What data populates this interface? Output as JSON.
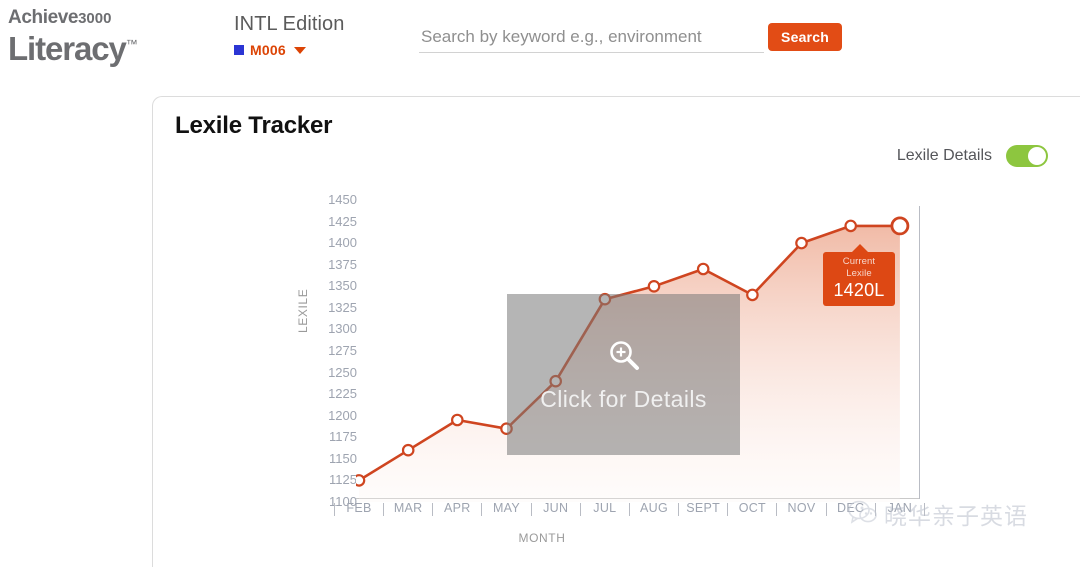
{
  "header": {
    "logo_top": "Achieve",
    "logo_top_sub": "3000",
    "logo_bottom": "Literacy",
    "logo_tm": "™",
    "edition_title": "INTL Edition",
    "edition_code": "M006",
    "caret_icon": "chevron-down-icon",
    "square_icon": "blue-square-icon",
    "square_color": "#2b35d4",
    "search_placeholder": "Search by keyword e.g., environment",
    "search_value": "",
    "search_button": "Search",
    "search_button_color": "#e24c15"
  },
  "card": {
    "title": "Lexile Tracker",
    "toggle_label": "Lexile Details",
    "toggle_state": "on",
    "toggle_color": "#8dc63f"
  },
  "overlay": {
    "text": "Click for Details",
    "icon": "magnifier-zoom-in-icon"
  },
  "tooltip": {
    "label": "Current Lexile",
    "value": "1420L",
    "color": "#dd4814"
  },
  "watermark": {
    "logo_icon": "wechat-icon",
    "text": "晓华亲子英语"
  },
  "chart_data": {
    "type": "line",
    "title": "Lexile Tracker",
    "xlabel": "MONTH",
    "ylabel": "LEXILE",
    "ylim": [
      1100,
      1450
    ],
    "ytick_step": 25,
    "yticks": [
      1450,
      1425,
      1400,
      1375,
      1350,
      1325,
      1300,
      1275,
      1250,
      1225,
      1200,
      1175,
      1150,
      1125,
      1100
    ],
    "categories": [
      "FEB",
      "MAR",
      "APR",
      "MAY",
      "JUN",
      "JUL",
      "AUG",
      "SEPT",
      "OCT",
      "NOV",
      "DEC",
      "JAN"
    ],
    "values": [
      1125,
      1160,
      1195,
      1185,
      1240,
      1335,
      1350,
      1370,
      1340,
      1400,
      1420,
      1420
    ],
    "series_name": "Lexile",
    "line_color": "#cf4520",
    "marker_fill": "#ffffff",
    "area_fill": "#f6cfc2",
    "grid": false,
    "legend": "none"
  }
}
